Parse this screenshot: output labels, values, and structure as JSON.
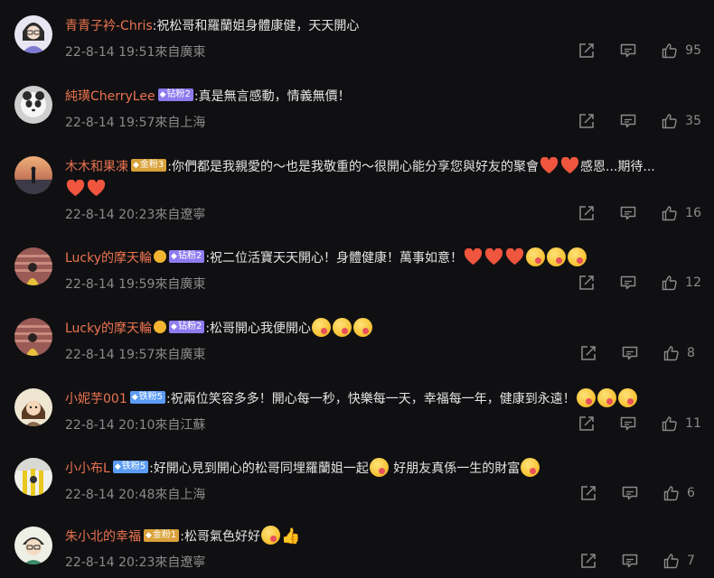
{
  "comments": [
    {
      "username": "青青子衿-Chris",
      "badge": "",
      "text": ":祝松哥和羅蘭姐身體康健，天天開心",
      "emoji_line2": [],
      "meta": "22-8-14 19:51來自廣東",
      "likes": "95"
    },
    {
      "username": "純璜CherryLee",
      "badge": "钻粉2",
      "text": ":真是無言感動，情義無價！",
      "emoji_line2": [],
      "meta": "22-8-14 19:57來自上海",
      "likes": "35"
    },
    {
      "username": "木木和果凍",
      "badge": "金粉3",
      "text": ":你們都是我親愛的～也是我敬重的～很開心能分享您與好友的聚會",
      "text_after": "感恩...期待...",
      "meta": "22-8-14 20:23來自遼寧",
      "likes": "16"
    },
    {
      "username": "Lucky的摩天輪",
      "badge": "钻粉2",
      "text": ":祝二位活寶天天開心！身體健康！萬事如意！",
      "meta": "22-8-14 19:59來自廣東",
      "likes": "12"
    },
    {
      "username": "Lucky的摩天輪",
      "badge": "钻粉2",
      "text": ":松哥開心我便開心",
      "meta": "22-8-14 19:57來自廣東",
      "likes": "8"
    },
    {
      "username": "小妮芋001",
      "badge": "铁粉5",
      "text": ":祝兩位笑容多多！開心每一秒，快樂每一天，幸福每一年，健康到永遠！",
      "meta": "22-8-14 20:10來自江蘇",
      "likes": "11"
    },
    {
      "username": "小小布L",
      "badge": "铁粉5",
      "text": ":好開心見到開心的松哥同埋羅蘭姐一起",
      "text_after": " 好朋友真係一生的財富",
      "meta": "22-8-14 20:48來自上海",
      "likes": "6"
    },
    {
      "username": "朱小北的幸福",
      "badge": "金粉1",
      "text": ":松哥氣色好好",
      "meta": "22-8-14 20:23來自遼寧",
      "likes": "7"
    }
  ],
  "icons": {
    "share": "share-icon",
    "reply": "comment-icon",
    "like": "thumbs-up-icon",
    "badge": "diamond-icon",
    "heart": "red-heart-emoji",
    "face": "kissing-face-emoji"
  },
  "colors": {
    "background": "#101012",
    "username": "#eb7350",
    "text": "#e4e4e4",
    "meta": "#8a8a8a"
  }
}
